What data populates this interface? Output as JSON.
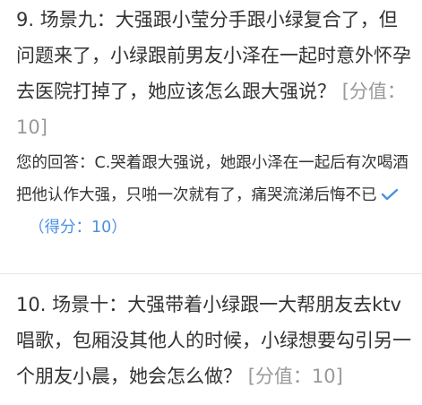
{
  "questions": [
    {
      "text": "9. 场景九：大强跟小莹分手跟小绿复合了，但问题来了，小绿跟前男友小泽在一起时意外怀孕去医院打掉了，她应该怎么跟大强说？",
      "score": "[分值：10]",
      "answer_prefix": "您的回答：",
      "answer": "C.哭着跟大强说，她跟小泽在一起后有次喝酒把他认作大强，只啪一次就有了，痛哭流涕后悔不已",
      "got_score": "（得分：10）",
      "correct_color": "#4a90e2"
    },
    {
      "text": "10. 场景十：大强带着小绿跟一大帮朋友去ktv唱歌，包厢没其他人的时候，小绿想要勾引另一个朋友小晨，她会怎么做？",
      "score": "[分值：10]"
    }
  ]
}
